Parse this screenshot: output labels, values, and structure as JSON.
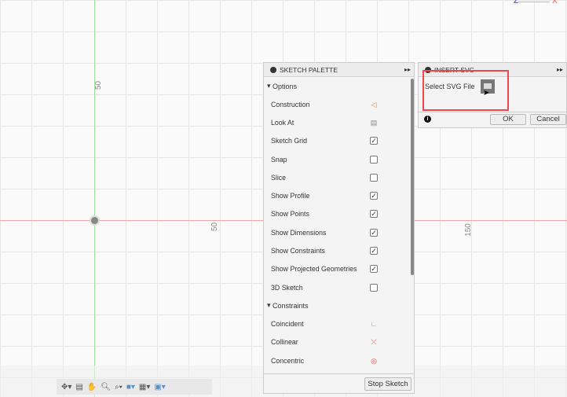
{
  "viewport": {
    "axis_labels": [
      "50",
      "50",
      "150"
    ],
    "viewcube": {
      "z": "Z",
      "x": "X"
    }
  },
  "sketch_palette": {
    "title": "SKETCH PALETTE",
    "options_header": "Options",
    "options": [
      {
        "label": "Construction",
        "control": "icon",
        "icon": "construction-icon"
      },
      {
        "label": "Look At",
        "control": "icon",
        "icon": "look-at-icon"
      },
      {
        "label": "Sketch Grid",
        "control": "checkbox",
        "checked": true
      },
      {
        "label": "Snap",
        "control": "checkbox",
        "checked": false
      },
      {
        "label": "Slice",
        "control": "checkbox",
        "checked": false
      },
      {
        "label": "Show Profile",
        "control": "checkbox",
        "checked": true
      },
      {
        "label": "Show Points",
        "control": "checkbox",
        "checked": true
      },
      {
        "label": "Show Dimensions",
        "control": "checkbox",
        "checked": true
      },
      {
        "label": "Show Constraints",
        "control": "checkbox",
        "checked": true
      },
      {
        "label": "Show Projected Geometries",
        "control": "checkbox",
        "checked": true
      },
      {
        "label": "3D Sketch",
        "control": "checkbox",
        "checked": false
      }
    ],
    "constraints_header": "Constraints",
    "constraints": [
      {
        "label": "Coincident",
        "icon": "coincident-icon"
      },
      {
        "label": "Collinear",
        "icon": "collinear-icon"
      },
      {
        "label": "Concentric",
        "icon": "concentric-icon"
      }
    ],
    "stop_label": "Stop Sketch"
  },
  "insert_svg": {
    "title": "INSERT SVG",
    "select_label": "Select SVG File",
    "ok": "OK",
    "cancel": "Cancel",
    "highlight_color": "#f0474d"
  }
}
